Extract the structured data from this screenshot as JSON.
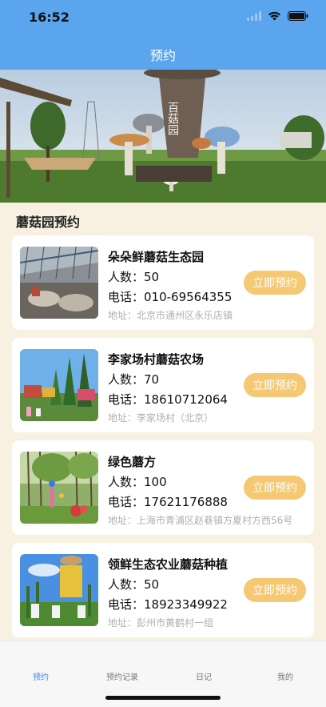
{
  "status_bar": {
    "time": "16:52"
  },
  "header": {
    "title": "预约"
  },
  "section": {
    "title": "蘑菇园预约"
  },
  "reserve_label": "立即预约",
  "cards": [
    {
      "name": "朵朵鲜蘑菇生态园",
      "count": "人数：50",
      "phone": "电话：010-69564355",
      "address": "地址：北京市通州区永乐店镇"
    },
    {
      "name": "李家场村蘑菇农场",
      "count": "人数：70",
      "phone": "电话：18610712064",
      "address": "地址：李家场村（北京）"
    },
    {
      "name": "绿色蘑方",
      "count": "人数：100",
      "phone": "电话：17621176888",
      "address": "地址：上海市青浦区赵巷镇方夏村方西56号"
    },
    {
      "name": "领鲜生态农业蘑菇种植",
      "count": "人数：50",
      "phone": "电话：18923349922",
      "address": "地址：彭州市黄鹤村一组"
    }
  ],
  "banner": {
    "sign_text": "百菇园"
  },
  "tabs": [
    {
      "label": "预约",
      "active": true
    },
    {
      "label": "预约记录",
      "active": false
    },
    {
      "label": "日记",
      "active": false
    },
    {
      "label": "我的",
      "active": false
    }
  ],
  "colors": {
    "header": "#5aa5ee",
    "button": "#f5c873",
    "background": "#f8f1e2",
    "active_tab": "#3a8ef0"
  }
}
